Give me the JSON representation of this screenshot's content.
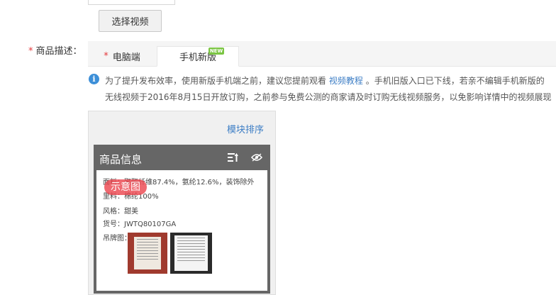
{
  "top": {
    "select_video_button": "选择视频"
  },
  "field": {
    "required_mark": "*",
    "label": "商品描述："
  },
  "tabs": {
    "pc": {
      "required_mark": "*",
      "label": "电脑端"
    },
    "mobile": {
      "label": "手机新版",
      "badge": "NEW"
    }
  },
  "notice": {
    "icon": "info-icon",
    "line1_before": "为了提升发布效率，使用新版手机端之前，建议您提前观看",
    "link": "视频教程",
    "line1_after": "。手机旧版入口已下线，若亲不编辑手机新版的",
    "line2": "无线视频于2016年8月15日开放订购，之前参与免费公测的商家请及时订购无线视频服务，以免影响详情中的视频展现"
  },
  "preview": {
    "sort_link": "模块排序",
    "module_title": "商品信息",
    "sample_badge": "示意图",
    "attributes": [
      "面料：聚酯纤维87.4%，氨纶12.6%，装饰除外",
      "里料：棉纶100%",
      "风格：甜美",
      "货号：JWTQ80107GA",
      "吊牌图："
    ],
    "icons": [
      "sort-icon",
      "eye-icon"
    ]
  },
  "colors": {
    "link": "#3d7ec5",
    "required": "#e4393c",
    "module_header": "#666666",
    "new_badge": "#7bc543",
    "sample_badge": "#ec4850"
  }
}
